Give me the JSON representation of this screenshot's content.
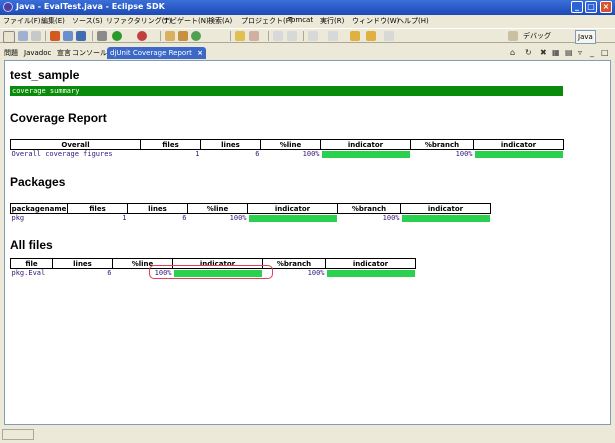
{
  "window": {
    "title": "Java - EvalTest.java - Eclipse SDK"
  },
  "menu": [
    "ファイル(F)",
    "編集(E)",
    "ソース(S)",
    "リファクタリング(T)",
    "ナビゲート(N)",
    "検索(A)",
    "プロジェクト(P)",
    "Tomcat",
    "実行(R)",
    "ウィンドウ(W)",
    "ヘルプ(H)"
  ],
  "perspectives": {
    "debug": "デバッグ",
    "java": "Java"
  },
  "tabs": [
    "問題",
    "Javadoc",
    "宣言",
    "コンソール",
    "djUnit Coverage Report"
  ],
  "report": {
    "title": "test_sample",
    "summary_label": "coverage summary",
    "coverage_heading": "Coverage Report",
    "coverage_table": {
      "headers": [
        "Overall",
        "files",
        "lines",
        "%line",
        "indicator",
        "%branch",
        "indicator"
      ],
      "row": {
        "name": "Overall coverage figures",
        "files": "1",
        "lines": "6",
        "line_pct": "100%",
        "line_fill": 1.0,
        "branch_pct": "100%",
        "branch_fill": 1.0
      }
    },
    "packages_heading": "Packages",
    "packages_table": {
      "headers": [
        "packagename",
        "files",
        "lines",
        "%line",
        "indicator",
        "%branch",
        "indicator"
      ],
      "row": {
        "name": "pkg",
        "files": "1",
        "lines": "6",
        "line_pct": "100%",
        "line_fill": 1.0,
        "branch_pct": "100%",
        "branch_fill": 1.0
      }
    },
    "files_heading": "All files",
    "files_table": {
      "headers": [
        "file",
        "lines",
        "%line",
        "indicator",
        "%branch",
        "indicator"
      ],
      "row": {
        "name": "pkg.Eval",
        "lines": "6",
        "line_pct": "100%",
        "line_fill": 1.0,
        "branch_pct": "100%",
        "branch_fill": 1.0
      }
    }
  },
  "colors": {
    "title_bar": "#1c49b7",
    "summary_bar": "#0a8a0a",
    "indicator_fill": "#2ad14e",
    "link_text": "#33157a",
    "highlight_outline": "#e04050",
    "active_tab": "#3c68c8"
  }
}
